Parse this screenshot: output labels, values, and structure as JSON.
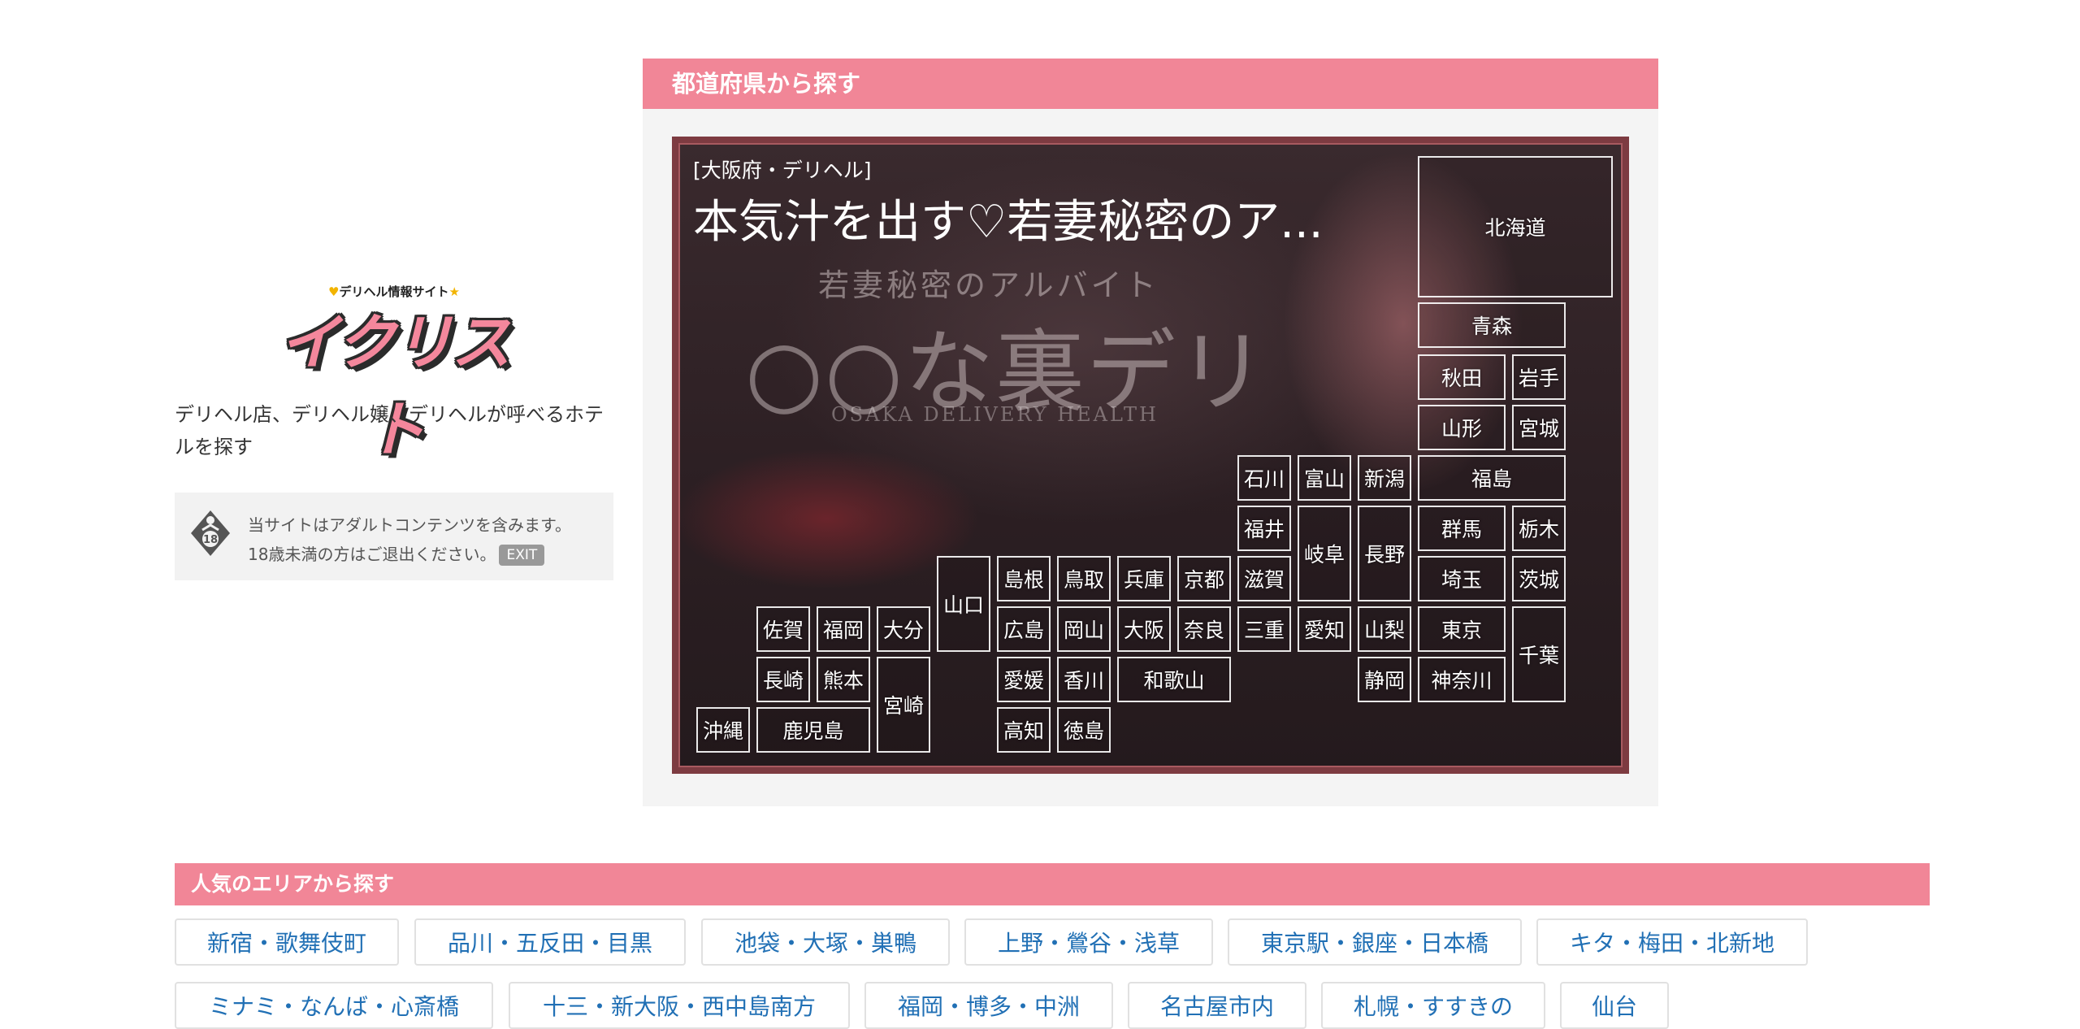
{
  "logo": {
    "tagline": "デリヘル情報サイト",
    "wordmark": "イクリスト"
  },
  "site_description": "デリヘル店、デリヘル嬢、デリヘルが呼べるホテルを探す",
  "adult_notice": {
    "badge_text": "18",
    "line1": "当サイトはアダルトコンテンツを含みます。",
    "line2": "18歳未満の方はご退出ください。",
    "exit_label": "EXIT"
  },
  "prefecture_section": {
    "title": "都道府県から探す",
    "banner": {
      "category": "[大阪府・デリヘル]",
      "shop_title": "本気汁を出す♡若妻秘密のア...",
      "image_text_1": "若妻秘密のアルバイト",
      "image_text_2": "○○な裏デリ",
      "image_text_3": "OSAKA DELIVERY HEALTH"
    },
    "prefectures": {
      "hokkaido": "北海道",
      "aomori": "青森",
      "akita": "秋田",
      "iwate": "岩手",
      "yamagata": "山形",
      "miyagi": "宮城",
      "fukushima": "福島",
      "ishikawa": "石川",
      "toyama": "富山",
      "niigata": "新潟",
      "fukui": "福井",
      "gifu": "岐阜",
      "nagano": "長野",
      "gunma": "群馬",
      "tochigi": "栃木",
      "shiga": "滋賀",
      "saitama": "埼玉",
      "ibaraki": "茨城",
      "mie": "三重",
      "aichi": "愛知",
      "yamanashi": "山梨",
      "tokyo": "東京",
      "chiba": "千葉",
      "shizuoka": "静岡",
      "kanagawa": "神奈川",
      "shimane": "島根",
      "tottori": "鳥取",
      "hyogo": "兵庫",
      "kyoto": "京都",
      "hiroshima": "広島",
      "okayama": "岡山",
      "osaka": "大阪",
      "nara": "奈良",
      "ehime": "愛媛",
      "kagawa": "香川",
      "wakayama": "和歌山",
      "kochi": "高知",
      "tokushima": "徳島",
      "yamaguchi": "山口",
      "saga": "佐賀",
      "fukuoka": "福岡",
      "oita": "大分",
      "nagasaki": "長崎",
      "kumamoto": "熊本",
      "miyazaki": "宮崎",
      "okinawa": "沖縄",
      "kagoshima": "鹿児島"
    }
  },
  "popular_areas": {
    "title": "人気のエリアから探す",
    "row1": [
      "新宿・歌舞伎町",
      "品川・五反田・目黒",
      "池袋・大塚・巣鴨",
      "上野・鶯谷・浅草",
      "東京駅・銀座・日本橋",
      "キタ・梅田・北新地"
    ],
    "row2": [
      "ミナミ・なんば・心斎橋",
      "十三・新大阪・西中島南方",
      "福岡・博多・中洲",
      "名古屋市内",
      "札幌・すすきの",
      "仙台"
    ]
  }
}
